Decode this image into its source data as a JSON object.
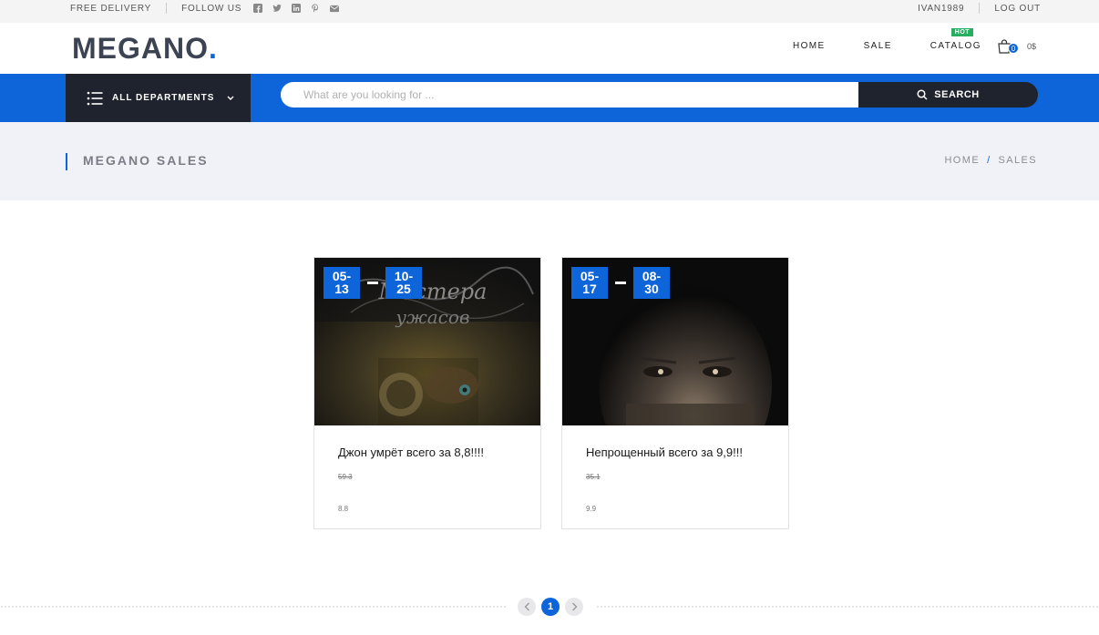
{
  "topbar": {
    "free_delivery": "FREE DELIVERY",
    "follow_us": "FOLLOW US",
    "social_icons": [
      "facebook-icon",
      "twitter-icon",
      "linkedin-icon",
      "pinterest-icon",
      "mail-icon"
    ],
    "username": "IVAN1989",
    "logout": "LOG OUT"
  },
  "header": {
    "logo_main": "MEGANO",
    "logo_dot": ".",
    "nav": {
      "home": "HOME",
      "sale": "SALE",
      "catalog": "CATALOG",
      "hot_badge": "HOT"
    },
    "cart_count": "0",
    "cart_total": "0$"
  },
  "searchbar": {
    "departments_label": "ALL DEPARTMENTS",
    "placeholder": "What are you looking for ...",
    "button_label": "SEARCH"
  },
  "page": {
    "title": "MEGANO SALES",
    "breadcrumb": {
      "home": "HOME",
      "separator": "/",
      "current": "SALES"
    }
  },
  "sales": [
    {
      "start": {
        "line1": "05-",
        "line2": "13"
      },
      "end": {
        "line1": "10-",
        "line2": "25"
      },
      "title": "Джон умрёт всего за 8,8!!!!",
      "old_price": "59.3",
      "new_price": "8.8"
    },
    {
      "start": {
        "line1": "05-",
        "line2": "17"
      },
      "end": {
        "line1": "08-",
        "line2": "30"
      },
      "title": "Непрощенный всего за 9,9!!!",
      "old_price": "35.1",
      "new_price": "9.9"
    }
  ],
  "pagination": {
    "current_page": "1"
  },
  "colors": {
    "accent": "#0d65d9",
    "dark": "#1f232d",
    "hot": "#27ae60",
    "band": "#f1f2f8"
  }
}
